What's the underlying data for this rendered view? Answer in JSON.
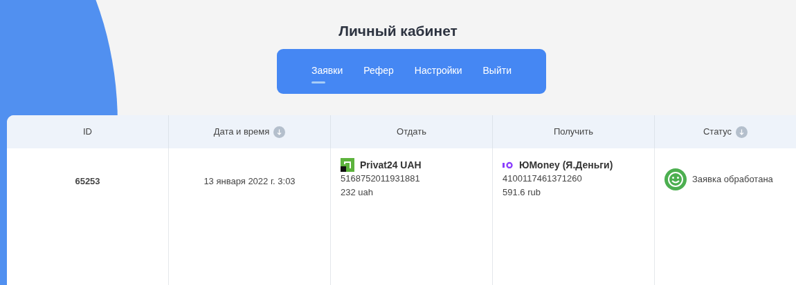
{
  "page_title": "Личный кабинет",
  "nav": [
    {
      "label": "Заявки",
      "selected": true
    },
    {
      "label": "Рефер",
      "selected": false
    },
    {
      "label": "Настройки",
      "selected": false
    },
    {
      "label": "Выйти",
      "selected": false
    }
  ],
  "table": {
    "columns": [
      {
        "label": "ID",
        "sortable": false
      },
      {
        "label": "Дата и время",
        "sortable": true
      },
      {
        "label": "Отдать",
        "sortable": false
      },
      {
        "label": "Получить",
        "sortable": false
      },
      {
        "label": "Статус",
        "sortable": true
      }
    ],
    "rows": [
      {
        "id": "65253",
        "datetime": "13 января 2022 г. 3:03",
        "give": {
          "method": "Privat24 UAH",
          "account": "5168752011931881",
          "amount": "232 uah"
        },
        "get": {
          "method": "ЮMoney (Я.Деньги)",
          "account": "4100117461371260",
          "amount": "591.6 rub"
        },
        "status": "Заявка обработана"
      }
    ]
  }
}
